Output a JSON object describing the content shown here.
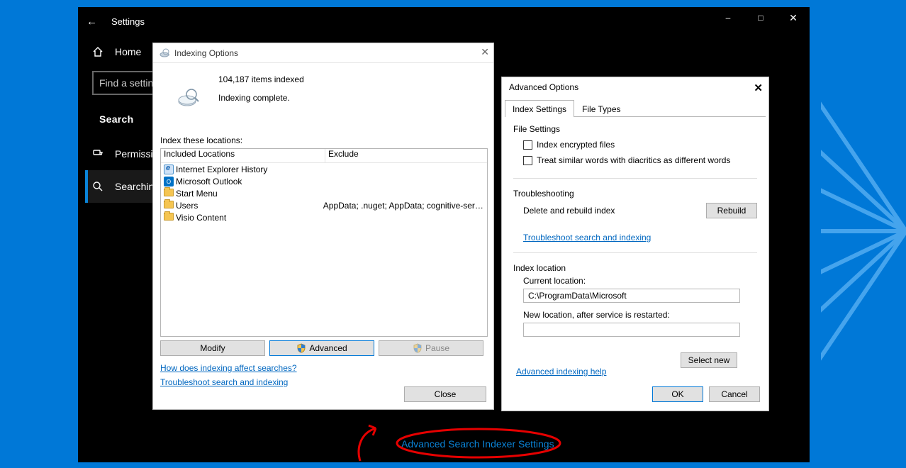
{
  "settings": {
    "window_title": "Settings",
    "home_label": "Home",
    "search_placeholder": "Find a setting",
    "section_header": "Search",
    "nav": [
      {
        "label": "Permissions & History"
      },
      {
        "label": "Searching Windows"
      }
    ],
    "content_link": "Advanced Search Indexer Settings"
  },
  "indexing": {
    "title": "Indexing Options",
    "count_line": "104,187 items indexed",
    "status_line": "Indexing complete.",
    "locations_label": "Index these locations:",
    "col_included": "Included Locations",
    "col_exclude": "Exclude",
    "rows": [
      {
        "icon": "ie",
        "name": "Internet Explorer History",
        "exclude": ""
      },
      {
        "icon": "ol",
        "name": "Microsoft Outlook",
        "exclude": ""
      },
      {
        "icon": "folder",
        "name": "Start Menu",
        "exclude": ""
      },
      {
        "icon": "folder",
        "name": "Users",
        "exclude": "AppData; .nuget; AppData; cognitive-services..."
      },
      {
        "icon": "folder",
        "name": "Visio Content",
        "exclude": ""
      }
    ],
    "btn_modify": "Modify",
    "btn_advanced": "Advanced",
    "btn_pause": "Pause",
    "link1": "How does indexing affect searches?",
    "link2": "Troubleshoot search and indexing",
    "btn_close": "Close"
  },
  "advanced": {
    "title": "Advanced Options",
    "tab_index": "Index Settings",
    "tab_file": "File Types",
    "file_settings": "File Settings",
    "cb_encrypted": "Index encrypted files",
    "cb_diacritics": "Treat similar words with diacritics as different words",
    "troubleshooting": "Troubleshooting",
    "delete_rebuild": "Delete and rebuild index",
    "btn_rebuild": "Rebuild",
    "link_troubleshoot": "Troubleshoot search and indexing",
    "index_location": "Index location",
    "current_location": "Current location:",
    "location_value": "C:\\ProgramData\\Microsoft",
    "new_location_label": "New location, after service is restarted:",
    "btn_select_new": "Select new",
    "link_help": "Advanced indexing help",
    "btn_ok": "OK",
    "btn_cancel": "Cancel"
  }
}
